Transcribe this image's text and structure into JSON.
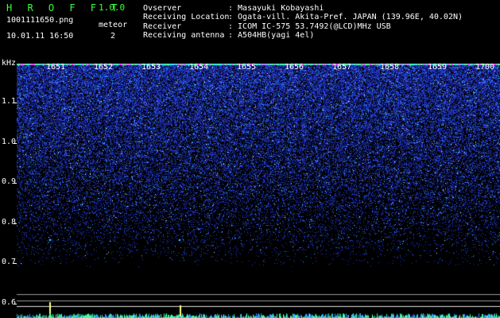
{
  "header": {
    "app_title": "H R O F F T",
    "app_version": "1.0.0",
    "file_name": "1001111650.png",
    "meteor_label": "meteor",
    "datetime": "10.01.11 16:50",
    "meteor_count": "2"
  },
  "info": [
    {
      "label": "Ovserver",
      "value": ": Masayuki Kobayashi"
    },
    {
      "label": "Receiving Location",
      "value": ": Ogata-vill. Akita-Pref. JAPAN (139.96E, 40.02N)"
    },
    {
      "label": "Receiver",
      "value": ": ICOM IC-575 53.7492(@LCD)MHz USB"
    },
    {
      "label": "Receiving antenna",
      "value": ": A504HB(yagi 4el)"
    }
  ],
  "axis": {
    "y_unit": "kHz",
    "y_ticks": [
      "1.1",
      "1.0",
      "0.9",
      "0.8",
      "0.7",
      "0.6"
    ],
    "x_ticks": [
      "1651",
      "1652",
      "1653",
      "1654",
      "1655",
      "1656",
      "1657",
      "1658",
      "1659",
      "1700"
    ]
  },
  "colors": {
    "title_green": "#3cff3c",
    "noise_blue": "#2a3cff",
    "signal_cyan": "#30e0ff",
    "top_band_green": "#40ff80",
    "top_band_magenta": "#ff40ff"
  }
}
